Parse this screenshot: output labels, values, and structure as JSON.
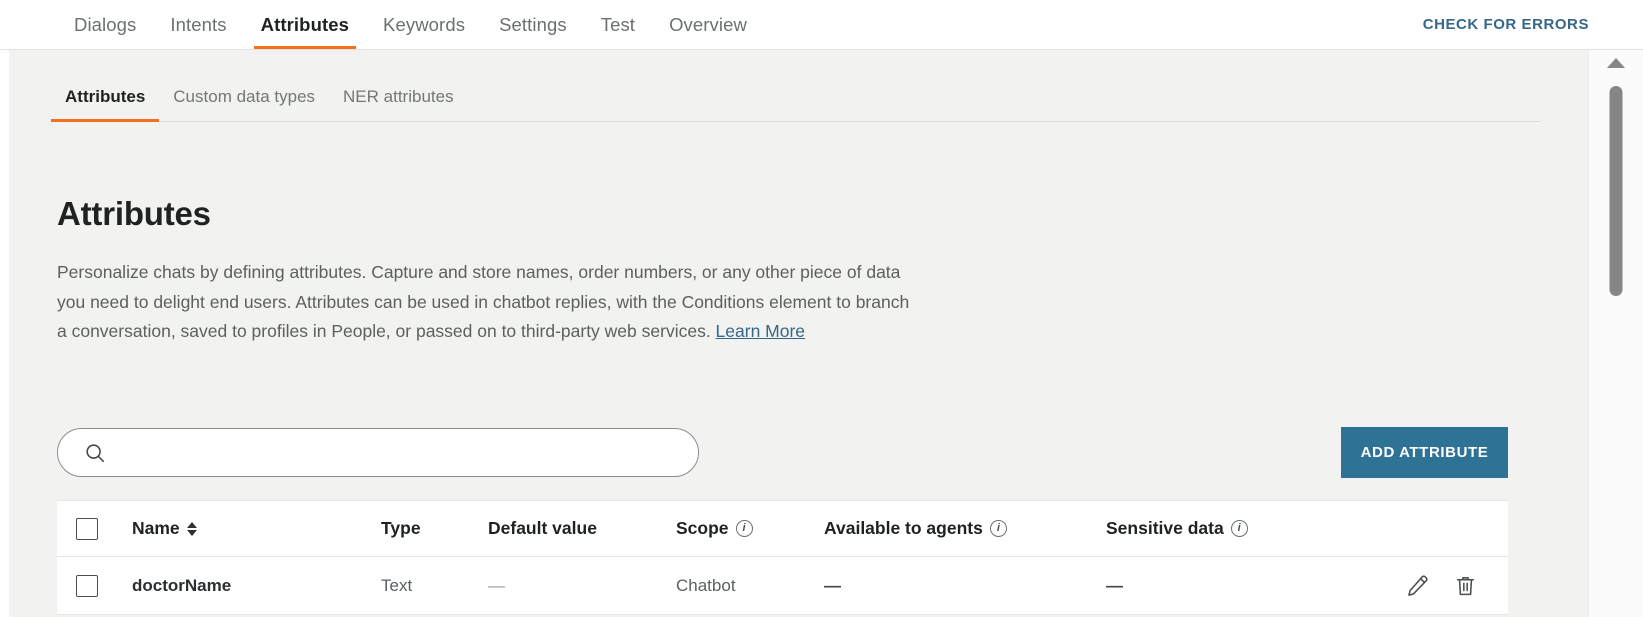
{
  "topnav": {
    "tabs": [
      {
        "label": "Dialogs",
        "active": false
      },
      {
        "label": "Intents",
        "active": false
      },
      {
        "label": "Attributes",
        "active": true
      },
      {
        "label": "Keywords",
        "active": false
      },
      {
        "label": "Settings",
        "active": false
      },
      {
        "label": "Test",
        "active": false
      },
      {
        "label": "Overview",
        "active": false
      }
    ],
    "check_errors_label": "CHECK FOR ERRORS",
    "check_errors_color": "#36678a"
  },
  "subtabs": [
    {
      "label": "Attributes",
      "active": true
    },
    {
      "label": "Custom data types",
      "active": false
    },
    {
      "label": "NER attributes",
      "active": false
    }
  ],
  "page": {
    "title": "Attributes",
    "description_part1": "Personalize chats by defining attributes. Capture and store names, order numbers, or any other piece of data you need to delight end users. Attributes can be used in chatbot replies, with the Conditions element to branch a conversation, saved to profiles in People, or passed on to third-party web services. ",
    "learn_more_label": "Learn More"
  },
  "search": {
    "value": "",
    "placeholder": "",
    "icon": "search-icon"
  },
  "add_attribute": {
    "label": "ADD ATTRIBUTE",
    "color": "#2e7296"
  },
  "table": {
    "columns": {
      "name": "Name",
      "type": "Type",
      "default_value": "Default value",
      "scope": "Scope",
      "available_to_agents": "Available to agents",
      "sensitive_data": "Sensitive data"
    },
    "info_glyph": "i",
    "rows": [
      {
        "checked": false,
        "name": "doctorName",
        "type": "Text",
        "default_value": "—",
        "scope": "Chatbot",
        "available_to_agents": "—",
        "sensitive_data": "—",
        "edit_label": "edit",
        "delete_label": "delete"
      }
    ]
  },
  "accent": {
    "tab_underline": "#f4701d",
    "link": "#36678a"
  }
}
